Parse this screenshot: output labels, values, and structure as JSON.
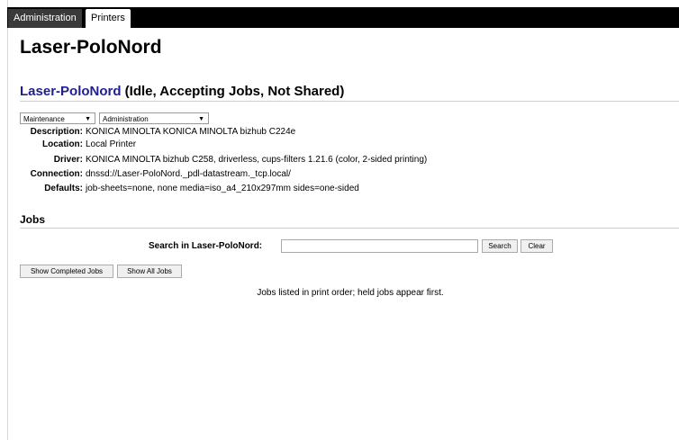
{
  "tabs": [
    {
      "label": "Administration"
    },
    {
      "label": "Printers"
    }
  ],
  "page_title": "Laser-PoloNord",
  "printer": {
    "name_link": "Laser-PoloNord",
    "status": " (Idle, Accepting Jobs, Not Shared)"
  },
  "selects": {
    "maintenance": "Maintenance",
    "administration": "Administration"
  },
  "info": {
    "description_label": "Description:",
    "description": "KONICA MINOLTA KONICA MINOLTA bizhub C224e",
    "location_label": "Location:",
    "location": "Local Printer",
    "driver_label": "Driver:",
    "driver": "KONICA MINOLTA bizhub C258, driverless, cups-filters 1.21.6 (color, 2-sided printing)",
    "connection_label": "Connection:",
    "connection": "dnssd://Laser-PoloNord._pdl-datastream._tcp.local/",
    "defaults_label": "Defaults:",
    "defaults": "job-sheets=none, none media=iso_a4_210x297mm sides=one-sided"
  },
  "jobs": {
    "heading": "Jobs",
    "search_label": "Search in Laser-PoloNord:",
    "search_value": "",
    "search_button": "Search",
    "clear_button": "Clear",
    "show_completed": "Show Completed Jobs",
    "show_all": "Show All Jobs",
    "note": "Jobs listed in print order; held jobs appear first."
  },
  "colors": {
    "topbar": "#000000",
    "link": "#1f1f8f"
  },
  "icons": {
    "dropdown_arrow": "chevron-down-icon"
  }
}
